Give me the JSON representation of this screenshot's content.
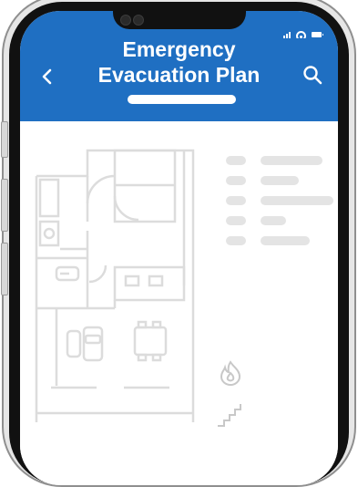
{
  "header": {
    "title_line1": "Emergency",
    "title_line2": "Evacuation Plan",
    "back_icon": "chevron-left-icon",
    "search_icon": "search-icon"
  },
  "status_bar": {
    "signal_icon": "cellular-signal-icon",
    "wifi_icon": "wifi-icon",
    "battery_icon": "battery-icon"
  },
  "floorplan": {
    "icon": "floor-plan-icon"
  },
  "map_icons": [
    "fire-icon",
    "stairs-icon"
  ],
  "legend_count": 5,
  "colors": {
    "header_bg": "#1f6fc2",
    "header_text": "#ffffff",
    "placeholder": "#e4e4e4",
    "plan_lines": "#dcdcdc"
  }
}
